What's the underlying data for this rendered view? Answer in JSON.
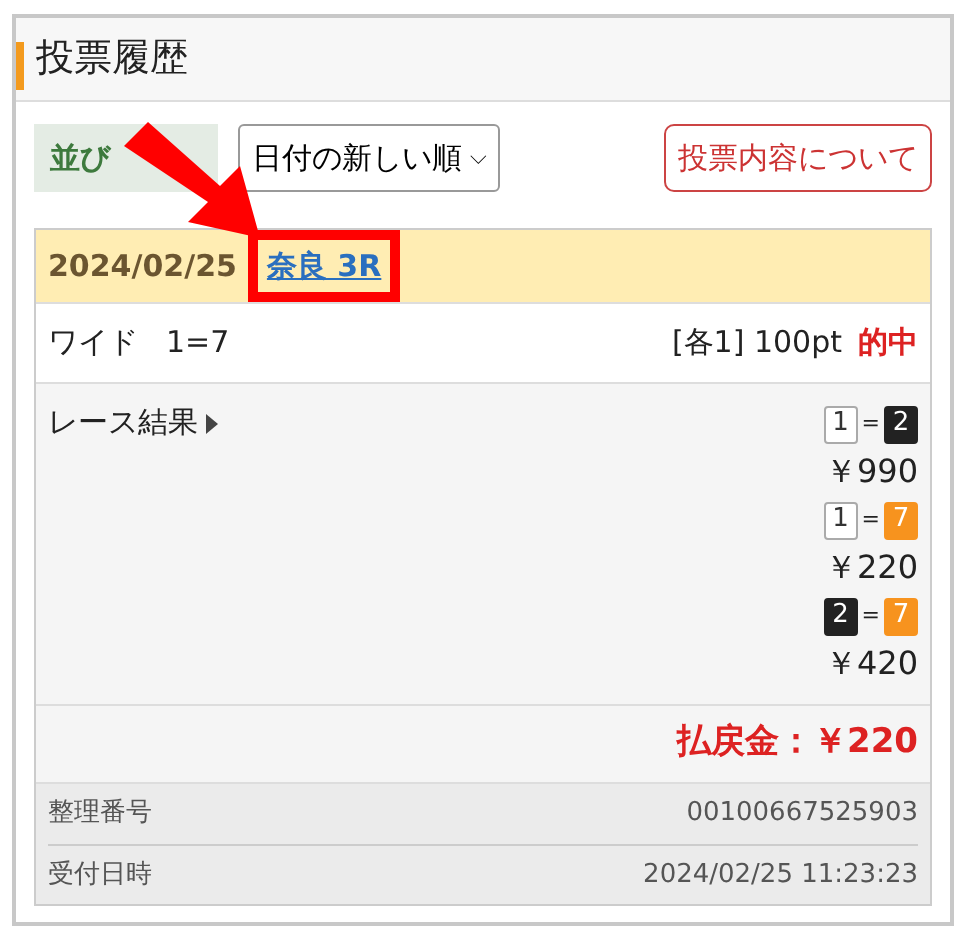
{
  "title": "投票履歴",
  "sort": {
    "label": "並び",
    "value": "日付の新しい順",
    "caret": "⌵"
  },
  "about_button": "投票内容について",
  "entry": {
    "date": "2024/02/25",
    "race": "奈良 3R",
    "race_highlighted": true,
    "bet_type": "ワイド",
    "bet_numbers": "1=7",
    "stake": "[各1] 100pt",
    "hit": true,
    "hit_label": "的中",
    "results_label": "レース結果",
    "results": [
      {
        "pair": [
          {
            "number": "1",
            "color": "#ffffff"
          },
          {
            "number": "2",
            "color": "#222222"
          }
        ],
        "joiner": "=",
        "payout": "￥990"
      },
      {
        "pair": [
          {
            "number": "1",
            "color": "#ffffff"
          },
          {
            "number": "7",
            "color": "#f7931e"
          }
        ],
        "joiner": "=",
        "payout": "￥220"
      },
      {
        "pair": [
          {
            "number": "2",
            "color": "#222222"
          },
          {
            "number": "7",
            "color": "#f7931e"
          }
        ],
        "joiner": "=",
        "payout": "￥420"
      }
    ],
    "refund": "払戻金：￥220",
    "info": [
      {
        "label": "整理番号",
        "value": "00100667525903"
      },
      {
        "label": "受付日時",
        "value": "2024/02/25 11:23:23"
      }
    ]
  },
  "pointer_arrow": true
}
